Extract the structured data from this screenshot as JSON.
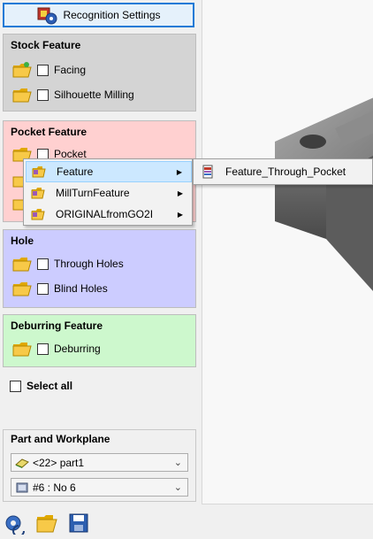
{
  "recognition_button": {
    "label": "Recognition Settings"
  },
  "stock_feature": {
    "title": "Stock Feature",
    "items": [
      {
        "label": "Facing",
        "checked": false
      },
      {
        "label": "Silhouette Milling",
        "checked": false
      }
    ]
  },
  "pocket_feature": {
    "title": "Pocket Feature",
    "items": [
      {
        "label": "Pocket",
        "checked": false
      }
    ]
  },
  "hole": {
    "title": "Hole",
    "items": [
      {
        "label": "Through Holes",
        "checked": false
      },
      {
        "label": "Blind Holes",
        "checked": false
      }
    ]
  },
  "deburring_feature": {
    "title": "Deburring Feature",
    "items": [
      {
        "label": "Deburring",
        "checked": false
      }
    ]
  },
  "select_all": {
    "label": "Select all",
    "checked": false
  },
  "part_and_workplane": {
    "title": "Part and Workplane",
    "part_select": {
      "value": "<22> part1"
    },
    "workplane_select": {
      "value": "#6 : No 6"
    }
  },
  "context_menu": {
    "items": [
      {
        "label": "Feature",
        "highlighted": true
      },
      {
        "label": "MillTurnFeature",
        "highlighted": false
      },
      {
        "label": "ORIGINALfromGO2I",
        "highlighted": false
      }
    ],
    "submenu": {
      "items": [
        {
          "label": "Feature_Through_Pocket"
        }
      ]
    }
  },
  "colors": {
    "stock_bg": "#d4d4d4",
    "pocket_bg": "#ffd0d0",
    "hole_bg": "#ccccff",
    "deburr_bg": "#cdf8cd",
    "accent": "#1a7ad6"
  }
}
